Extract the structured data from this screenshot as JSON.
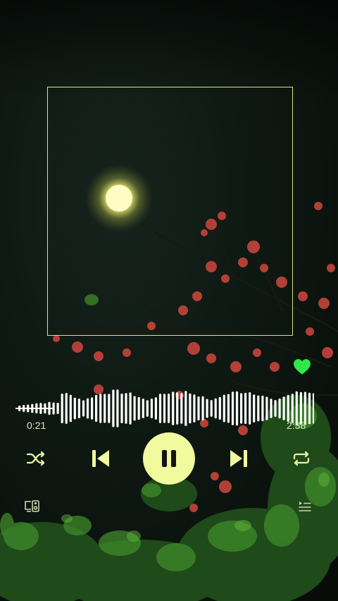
{
  "player": {
    "elapsed": "0:21",
    "total": "2:38",
    "progress": 0.13,
    "liked": true,
    "playing": true
  },
  "colors": {
    "accent": "#f1fa9c",
    "heart": "#2ee84a",
    "frame": "#d7e58a",
    "background": "#0b120e",
    "waveform": "#ffffff"
  },
  "icons": {
    "shuffle": "shuffle-icon",
    "previous": "skip-previous-icon",
    "play_pause": "pause-icon",
    "next": "skip-next-icon",
    "repeat": "repeat-icon",
    "devices": "devices-icon",
    "queue": "queue-icon",
    "like": "heart-icon"
  }
}
